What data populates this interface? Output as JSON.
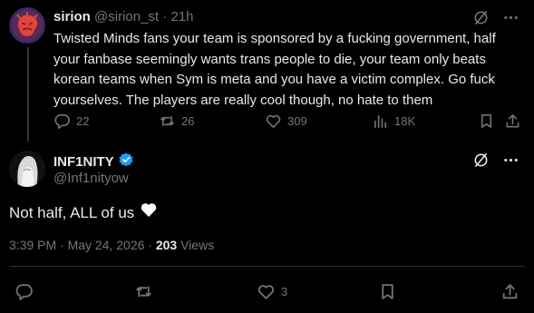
{
  "reply_to": {
    "author_name": "sirion",
    "author_handle": "@sirion_st",
    "separator": "·",
    "time": "21h",
    "text": "Twisted Minds fans your team is sponsored by a fucking government, half your fanbase seemingly wants trans people to die, your team only beats korean teams when Sym is meta and you have a victim complex. Go fuck yourselves. The players are really cool though, no hate to them",
    "stats": {
      "replies": "22",
      "reposts": "26",
      "likes": "309",
      "views": "18K"
    }
  },
  "main_post": {
    "author_name": "INF1NITY",
    "author_handle": "@Inf1nityow",
    "verified": true,
    "text": "Not half, ALL of us",
    "emoji_icon": "white-heart-icon",
    "timestamp": "3:39 PM · May 24, 2026 ·",
    "views_count": "203",
    "views_label": "Views",
    "stats": {
      "likes": "3"
    }
  },
  "colors": {
    "background": "#000000",
    "text_primary": "#e7e9ea",
    "text_muted": "#71767b",
    "verified_blue": "#1d9bf0",
    "divider": "#2f3336"
  }
}
